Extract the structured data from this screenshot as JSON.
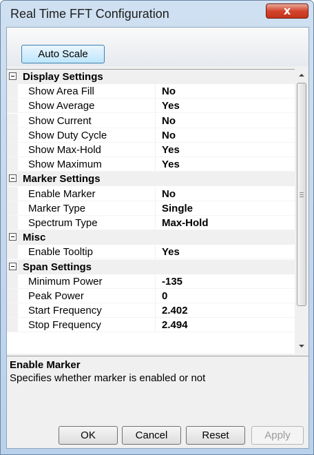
{
  "window": {
    "title": "Real Time FFT Configuration",
    "close_glyph": "x"
  },
  "toolbar": {
    "auto_scale_label": "Auto Scale"
  },
  "grid": {
    "rows": [
      {
        "kind": "category",
        "label": "Display Settings"
      },
      {
        "kind": "property",
        "name": "Show Area Fill",
        "value": "No"
      },
      {
        "kind": "property",
        "name": "Show Average",
        "value": "Yes"
      },
      {
        "kind": "property",
        "name": "Show Current",
        "value": "No"
      },
      {
        "kind": "property",
        "name": "Show Duty Cycle",
        "value": "No"
      },
      {
        "kind": "property",
        "name": "Show Max-Hold",
        "value": "Yes"
      },
      {
        "kind": "property",
        "name": "Show Maximum",
        "value": "Yes"
      },
      {
        "kind": "category",
        "label": "Marker Settings"
      },
      {
        "kind": "property",
        "name": "Enable Marker",
        "value": "No"
      },
      {
        "kind": "property",
        "name": "Marker Type",
        "value": "Single"
      },
      {
        "kind": "property",
        "name": "Spectrum Type",
        "value": "Max-Hold"
      },
      {
        "kind": "category",
        "label": "Misc"
      },
      {
        "kind": "property",
        "name": "Enable Tooltip",
        "value": "Yes"
      },
      {
        "kind": "category",
        "label": "Span Settings"
      },
      {
        "kind": "property",
        "name": "Minimum Power",
        "value": "-135"
      },
      {
        "kind": "property",
        "name": "Peak Power",
        "value": "0"
      },
      {
        "kind": "property",
        "name": "Start Frequency",
        "value": "2.402"
      },
      {
        "kind": "property",
        "name": "Stop Frequency",
        "value": "2.494"
      }
    ]
  },
  "help": {
    "title": "Enable Marker",
    "description": "Specifies whether marker is enabled or not"
  },
  "buttons": {
    "ok": "OK",
    "cancel": "Cancel",
    "reset": "Reset",
    "apply": "Apply"
  },
  "colors": {
    "close_button": "#d2452b",
    "auto_scale_border": "#3c7fb1"
  }
}
